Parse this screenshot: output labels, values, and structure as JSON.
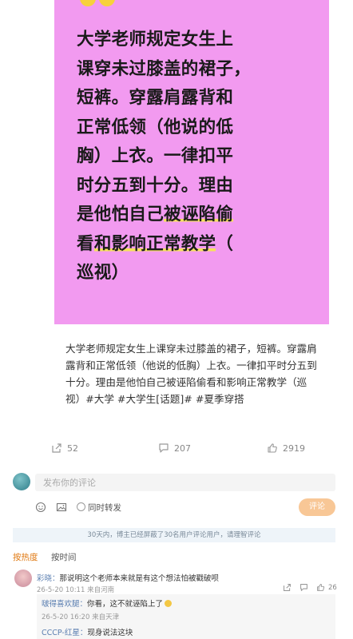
{
  "image_card": {
    "lines": [
      "大学老师规定女生上",
      "课穿未过膝盖的裙子，",
      "短裤。穿露肩露背和",
      "正常低领（他说的低",
      "胸）上衣。一律扣平",
      "时分五到十分。理由"
    ],
    "line7_pre": "是他怕自己",
    "line7_hl": "被诬陷偷",
    "line8_pre": "看",
    "line8_hl": "和影响正常教学",
    "line8_post": "（",
    "line9": "巡视）",
    "highlight_color": "#f6e35a",
    "background_color": "#f29af0"
  },
  "caption": "大学老师规定女生上课穿未过膝盖的裙子，短裤。穿露肩露背和正常低领（他说的低胸）上衣。一律扣平时分五到十分。理由是他怕自己被诬陷偷看和影响正常教学（巡视）#大学 #大学生[话题]# #夏季穿搭",
  "actions": {
    "share_count": "52",
    "comment_count": "207",
    "like_count": "2919"
  },
  "comment_box": {
    "placeholder": "发布你的评论",
    "repost_label": "同时转发",
    "submit_label": "评论"
  },
  "notice": "30天内，博主已经屏蔽了30名用户评论用户，请理智评论",
  "sort": {
    "hot": "按热度",
    "time": "按时间"
  },
  "comments": [
    {
      "user": "彩晓：",
      "text": "那说明这个老师本来就是有这个想法怕被戳破呗",
      "meta": "26-5-20 10:11 来自河南",
      "likes": "26",
      "replies": [
        {
          "user": "啵得喜欢腿：",
          "text": "你看，这不就诬陷上了",
          "meta": "26-5-20 16:20 来自天津"
        },
        {
          "user": "CCCP-红星：",
          "text": "现身说法这块"
        }
      ]
    }
  ],
  "colors": {
    "accent_orange": "#e07a14",
    "submit_button": "#f8c796",
    "link_blue": "#5b7fb1"
  }
}
